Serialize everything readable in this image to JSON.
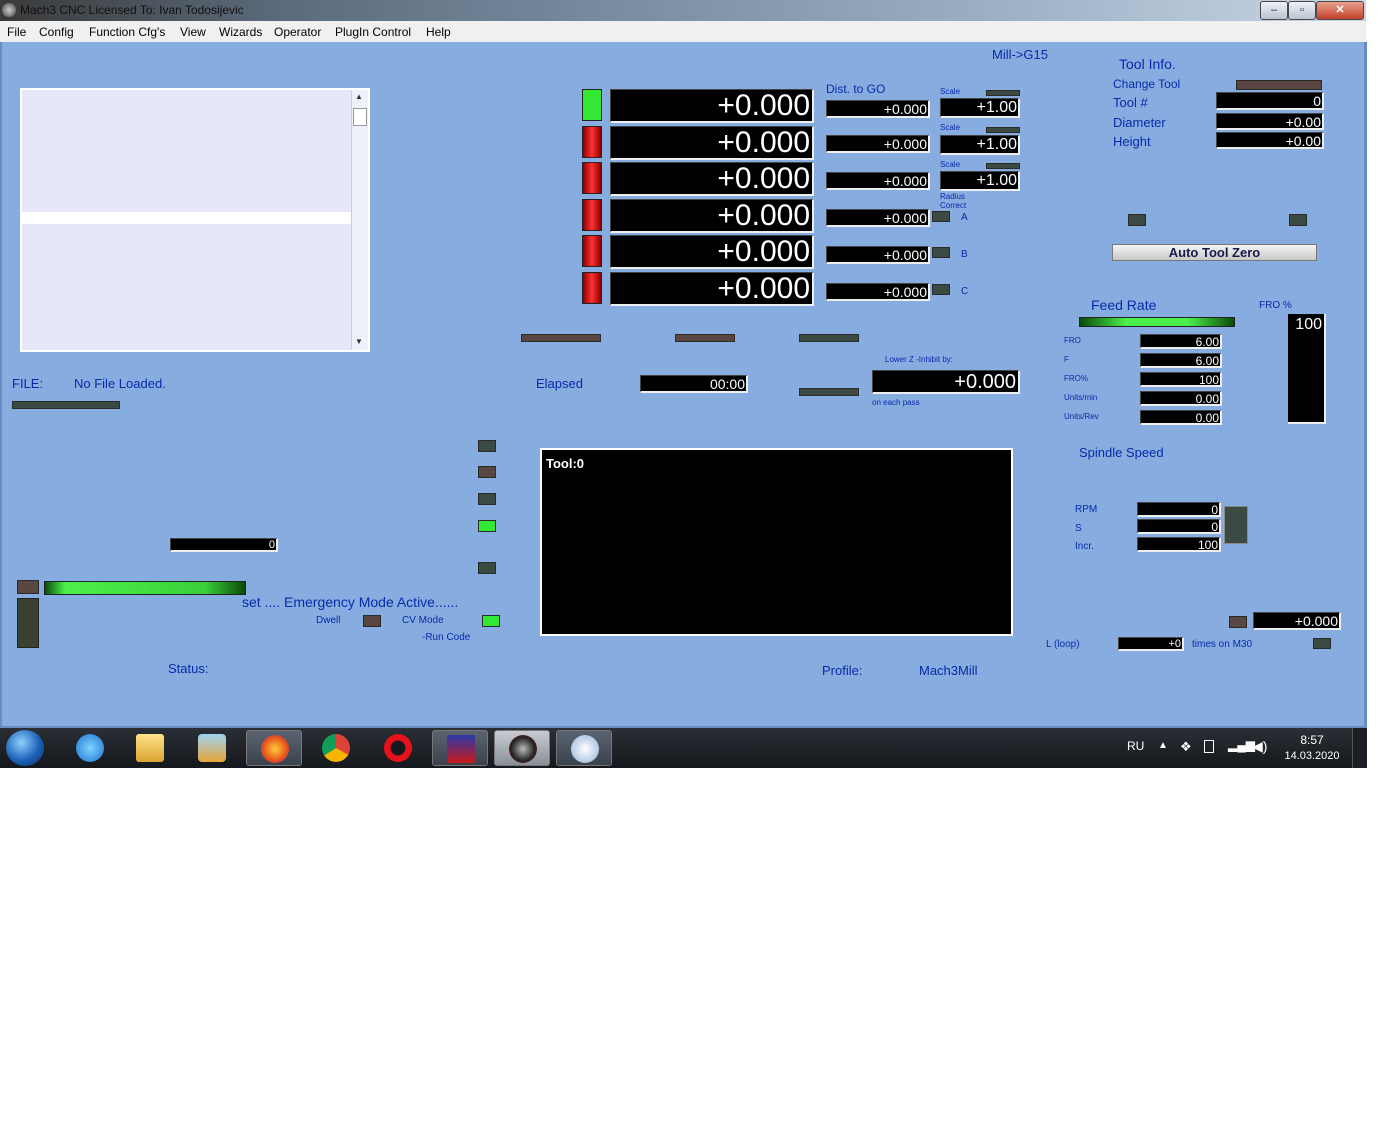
{
  "window": {
    "title": "Mach3 CNC  Licensed To: Ivan Todosijevic",
    "min_label": "‒",
    "max_label": "▫",
    "close_label": "✕"
  },
  "menu": [
    "File",
    "Config",
    "Function Cfg's",
    "View",
    "Wizards",
    "Operator",
    "PlugIn Control",
    "Help"
  ],
  "header": {
    "mode": "Mill->G15"
  },
  "dro": {
    "axes": [
      {
        "value": "+0.000",
        "led": "green",
        "dist": "+0.000",
        "scale": "+1.00",
        "scale_label": "Scale"
      },
      {
        "value": "+0.000",
        "led": "red",
        "dist": "+0.000",
        "scale": "+1.00",
        "scale_label": "Scale"
      },
      {
        "value": "+0.000",
        "led": "red",
        "dist": "+0.000",
        "scale": "+1.00",
        "scale_label": "Scale"
      },
      {
        "value": "+0.000",
        "led": "red",
        "dist": "+0.000",
        "axis": "A"
      },
      {
        "value": "+0.000",
        "led": "red",
        "dist": "+0.000",
        "axis": "B"
      },
      {
        "value": "+0.000",
        "led": "red",
        "dist": "+0.000",
        "axis": "C"
      }
    ],
    "dist_to_go_label": "Dist. to GO",
    "radius_correct_label": "Radius Correct"
  },
  "tool_info": {
    "title": "Tool Info.",
    "change_tool": "Change Tool",
    "tool_num_label": "Tool #",
    "tool_num": "0",
    "diameter_label": "Diameter",
    "diameter": "+0.00",
    "height_label": "Height",
    "height": "+0.00",
    "auto_tool_zero": "Auto Tool Zero"
  },
  "file": {
    "label": "FILE:",
    "name": "No File Loaded."
  },
  "elapsed": {
    "label": "Elapsed",
    "value": "00:00"
  },
  "lower_z": {
    "label": "Lower Z -Inhibit by:",
    "value": "+0.000",
    "sub": "on each pass"
  },
  "feed": {
    "title": "Feed Rate",
    "fro_pct_label": "FRO %",
    "fro_pct": "100",
    "rows": [
      {
        "label": "FRO",
        "value": "6.00"
      },
      {
        "label": "F",
        "value": "6.00"
      },
      {
        "label": "FRO%",
        "value": "100"
      },
      {
        "label": "Units/min",
        "value": "0.00"
      },
      {
        "label": "Units/Rev",
        "value": "0.00"
      }
    ]
  },
  "spindle": {
    "title": "Spindle Speed",
    "rows": [
      {
        "label": "RPM",
        "value": "0"
      },
      {
        "label": "S",
        "value": "0"
      },
      {
        "label": "Incr.",
        "value": "100"
      }
    ]
  },
  "toolpath": {
    "label": "Tool:0"
  },
  "status": {
    "message": "set .... Emergency Mode Active......",
    "dwell": "Dwell",
    "cv_mode": "CV Mode",
    "run_code": "-Run Code",
    "status_label": "Status:",
    "profile_label": "Profile:",
    "profile": "Mach3Mill",
    "misc_value": "0"
  },
  "loop": {
    "label": "L (loop)",
    "value": "+0",
    "times": "times on M30",
    "offset": "+0.000"
  },
  "taskbar": {
    "lang": "RU",
    "time": "8:57",
    "date": "14.03.2020"
  }
}
